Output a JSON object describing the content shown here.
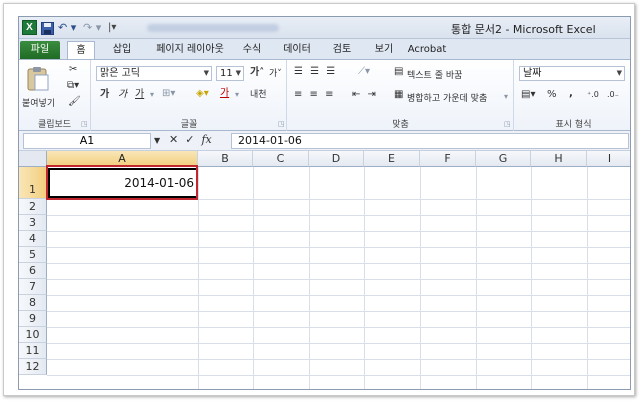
{
  "window": {
    "title": "통합 문서2 - Microsoft Excel",
    "app_icon": "X"
  },
  "quick_access": {
    "undo": "↶ ▾",
    "redo": "↷ ▾",
    "customize": "|▾"
  },
  "tabs": [
    {
      "label": "파일"
    },
    {
      "label": "홈"
    },
    {
      "label": "삽입"
    },
    {
      "label": "페이지 레이아웃"
    },
    {
      "label": "수식"
    },
    {
      "label": "데이터"
    },
    {
      "label": "검토"
    },
    {
      "label": "보기"
    },
    {
      "label": "Acrobat"
    }
  ],
  "ribbon": {
    "clipboard": {
      "paste": "붙여넣기",
      "label": "클립보드"
    },
    "font": {
      "name": "맑은 고딕",
      "size": "11",
      "grow": "가",
      "shrink": "가",
      "bold": "가",
      "italic": "가",
      "underline": "가",
      "font_color": "가",
      "phonetic": "내천",
      "label": "글꼴"
    },
    "alignment": {
      "wrap_text": "텍스트 줄 바꿈",
      "merge_center": "병합하고 가운데 맞춤",
      "label": "맞춤"
    },
    "number": {
      "format": "날짜",
      "percent": "%",
      "comma": ",",
      "label": "표시 형식"
    }
  },
  "formula_bar": {
    "name_box": "A1",
    "cancel": "✕",
    "enter": "✓",
    "fx": "fx",
    "value": "2014-01-06"
  },
  "sheet": {
    "columns": [
      "A",
      "B",
      "C",
      "D",
      "E",
      "F",
      "G",
      "H",
      "I"
    ],
    "rows": [
      "1",
      "2",
      "3",
      "4",
      "5",
      "6",
      "7",
      "8",
      "9",
      "10",
      "11",
      "12"
    ],
    "active_cell": "A1",
    "cell_a1": "2014-01-06"
  },
  "colors": {
    "file_tab": "#2e7d32",
    "highlight": "#c0262d",
    "active_header": "#f2cf7e"
  }
}
